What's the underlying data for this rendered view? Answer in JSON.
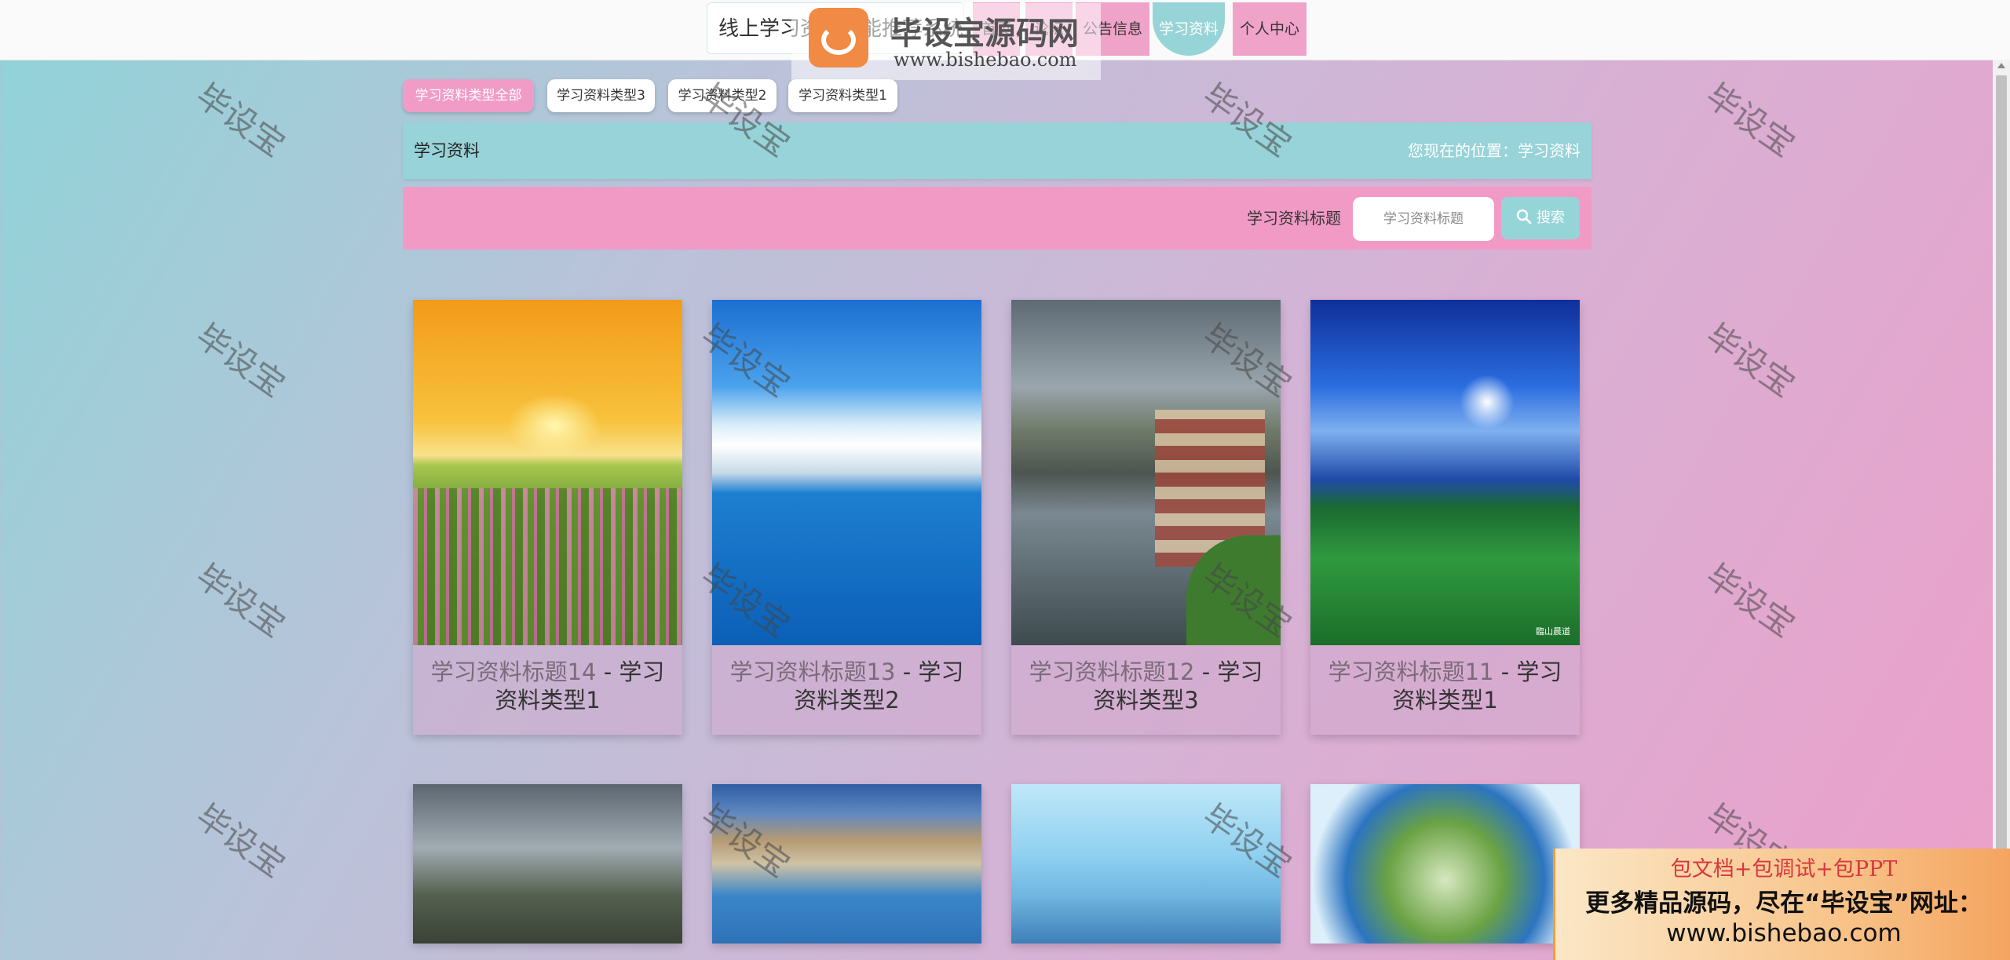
{
  "header": {
    "site_title": "线上学习资源智能推荐系统",
    "nav": {
      "home": "首页",
      "forum": "论坛",
      "notice": "公告信息",
      "study": "学习资料",
      "personal": "个人中心"
    }
  },
  "logo_overlay": {
    "title": "毕设宝源码网",
    "url": "www.bishebao.com"
  },
  "categories": [
    "学习资料类型全部",
    "学习资料类型3",
    "学习资料类型2",
    "学习资料类型1"
  ],
  "breadcrumb": {
    "title": "学习资料",
    "location": "您现在的位置：学习资料"
  },
  "search": {
    "label": "学习资料标题",
    "placeholder": "学习资料标题",
    "button": "搜索"
  },
  "cards": [
    {
      "title": "学习资料标题14",
      "sep": " - ",
      "kind": "学习资料类型1"
    },
    {
      "title": "学习资料标题13",
      "sep": " - ",
      "kind": "学习资料类型2"
    },
    {
      "title": "学习资料标题12",
      "sep": " - ",
      "kind": "学习资料类型3"
    },
    {
      "title": "学习资料标题11",
      "sep": " - ",
      "kind": "学习资料类型1"
    }
  ],
  "image_watermark": "臨山晨道",
  "watermark_text": "毕设宝",
  "ad": {
    "line1": "包文档+包调试+包PPT",
    "line2": "更多精品源码，尽在“毕设宝”网址：",
    "line3": "www.bishebao.com"
  },
  "colors": {
    "accent_pink": "#f09cc7",
    "accent_teal": "#97d3d8"
  }
}
